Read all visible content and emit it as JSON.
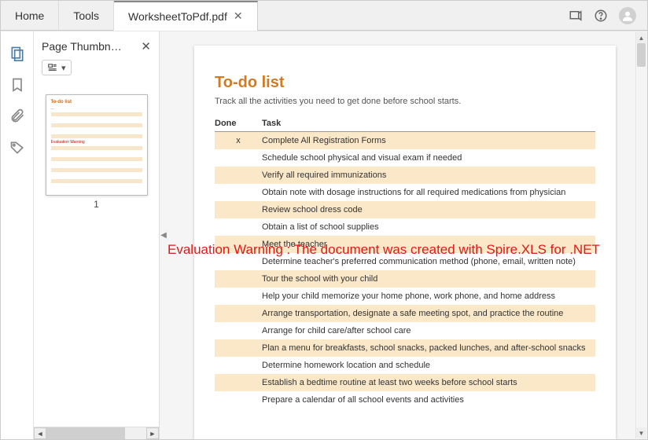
{
  "tabs": {
    "home": "Home",
    "tools": "Tools",
    "doc": "WorksheetToPdf.pdf"
  },
  "sidepanel": {
    "title": "Page Thumbn…",
    "thumb_number": "1"
  },
  "document": {
    "title": "To-do list",
    "subtitle": "Track all the activities you need to get done before school starts.",
    "headers": {
      "done": "Done",
      "task": "Task"
    },
    "rows": [
      {
        "done": "x",
        "task": "Complete All Registration Forms",
        "shaded": true
      },
      {
        "done": "",
        "task": "Schedule school physical and visual exam if needed",
        "shaded": false
      },
      {
        "done": "",
        "task": "Verify all required immunizations",
        "shaded": true
      },
      {
        "done": "",
        "task": "Obtain note with dosage instructions for all required medications from physician",
        "shaded": false
      },
      {
        "done": "",
        "task": "Review school dress code",
        "shaded": true
      },
      {
        "done": "",
        "task": "Obtain a list of school supplies",
        "shaded": false
      },
      {
        "done": "",
        "task": "Meet the teacher",
        "shaded": true
      },
      {
        "done": "",
        "task": "Determine teacher's preferred communication method (phone, email, written note)",
        "shaded": false
      },
      {
        "done": "",
        "task": "Tour the school with your child",
        "shaded": true
      },
      {
        "done": "",
        "task": "Help your child memorize your home phone, work phone, and home address",
        "shaded": false
      },
      {
        "done": "",
        "task": "Arrange transportation, designate a safe meeting spot, and practice the routine",
        "shaded": true
      },
      {
        "done": "",
        "task": "Arrange for child care/after school care",
        "shaded": false
      },
      {
        "done": "",
        "task": "Plan a menu for breakfasts, school snacks, packed lunches, and after-school snacks",
        "shaded": true
      },
      {
        "done": "",
        "task": "Determine homework location and schedule",
        "shaded": false
      },
      {
        "done": "",
        "task": "Establish a bedtime routine at least two weeks before school starts",
        "shaded": true
      },
      {
        "done": "",
        "task": "Prepare a calendar of all school events and activities",
        "shaded": false
      }
    ],
    "warning": "Evaluation Warning : The document was created with  Spire.XLS for .NET"
  }
}
